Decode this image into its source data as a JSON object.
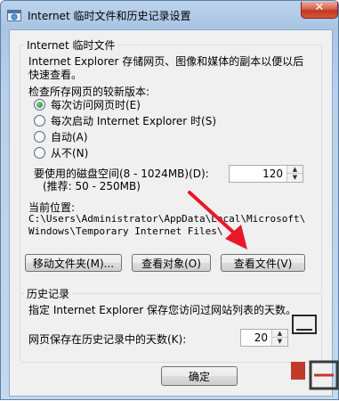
{
  "window": {
    "title": "Internet 临时文件和历史记录设置",
    "icon": "internet-options-icon"
  },
  "temp_files": {
    "group_title": "Internet 临时文件",
    "description_line1": "Internet Explorer 存储网页、图像和媒体的副本以便以后",
    "description_line2": "快速查看。",
    "check_label": "检查所存网页的较新版本:",
    "options": [
      {
        "label": "每次访问网页时(E)",
        "selected": true
      },
      {
        "label": "每次启动 Internet Explorer 时(S)",
        "selected": false
      },
      {
        "label": "自动(A)",
        "selected": false
      },
      {
        "label": "从不(N)",
        "selected": false
      }
    ],
    "disk_label": "要使用的磁盘空间(8 - 1024MB)(D):",
    "disk_hint": "(推荐: 50 - 250MB)",
    "disk_value": "120",
    "location_label": "当前位置:",
    "location_line1": "C:\\Users\\Administrator\\AppData\\Local\\Microsoft\\",
    "location_line2": "Windows\\Temporary Internet Files\\",
    "move_button": "移动文件夹(M)...",
    "view_objects_button": "查看对象(O)",
    "view_files_button": "查看文件(V)"
  },
  "history": {
    "group_title": "历史记录",
    "description": "指定 Internet Explorer 保存您访问过网站列表的天数。",
    "days_label": "网页保存在历史记录中的天数(K):",
    "days_value": "20"
  },
  "footer": {
    "ok_button": "确定"
  },
  "colors": {
    "arrow": "#e8182a",
    "window_frame": "#a9c5e4",
    "dialog_bg": "#f0f0f0"
  }
}
